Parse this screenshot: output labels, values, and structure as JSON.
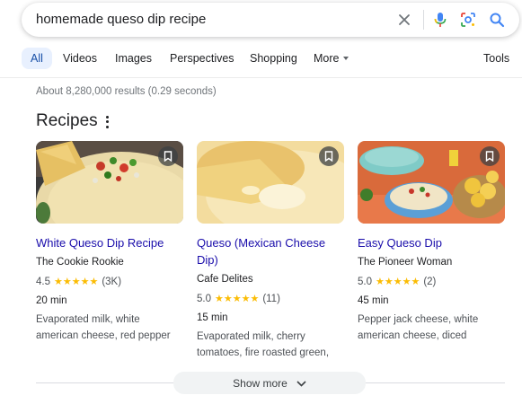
{
  "search": {
    "query": "homemade queso dip recipe"
  },
  "tabs": [
    {
      "label": "All",
      "active": true
    },
    {
      "label": "Videos"
    },
    {
      "label": "Images"
    },
    {
      "label": "Perspectives"
    },
    {
      "label": "Shopping"
    },
    {
      "label": "More"
    },
    {
      "label": "Tools"
    }
  ],
  "results_stats": "About 8,280,000 results (0.29 seconds)",
  "section": {
    "title": "Recipes"
  },
  "recipes": [
    {
      "title": "White Queso Dip Recipe",
      "source": "The Cookie Rookie",
      "rating": "4.5",
      "stars": "★★★★★",
      "reviews": "(3K)",
      "time": "20 min",
      "ingredients": "Evaporated milk, white american cheese, red pepper"
    },
    {
      "title": "Queso (Mexican Cheese Dip)",
      "source": "Cafe Delites",
      "rating": "5.0",
      "stars": "★★★★★",
      "reviews": "(11)",
      "time": "15 min",
      "ingredients": "Evaporated milk, cherry tomatoes, fire roasted green,"
    },
    {
      "title": "Easy Queso Dip",
      "source": "The Pioneer Woman",
      "rating": "5.0",
      "stars": "★★★★★",
      "reviews": "(2)",
      "time": "45 min",
      "ingredients": "Pepper jack cheese, white american cheese, diced"
    }
  ],
  "show_more": "Show more",
  "colors": {
    "link": "#1a0dab",
    "star": "#fbbc04",
    "active_tab_bg": "#e8f0fe",
    "google_blue": "#4285f4",
    "google_red": "#ea4335",
    "google_yellow": "#fbbc04",
    "google_green": "#34a853"
  },
  "icons": [
    "close-icon",
    "mic-icon",
    "lens-icon",
    "search-icon",
    "more-vert-icon",
    "bookmark-icon",
    "chevron-down-icon"
  ]
}
